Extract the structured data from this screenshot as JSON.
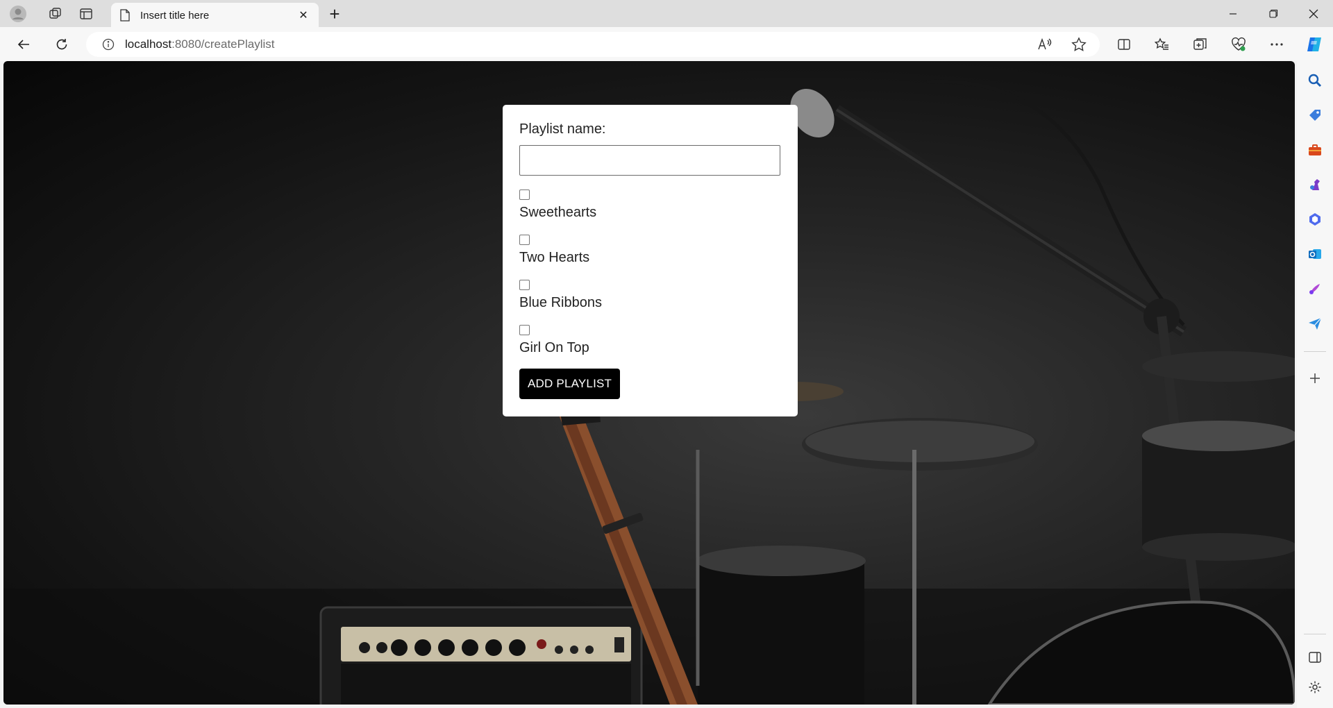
{
  "browser": {
    "tab_title": "Insert title here",
    "url_host": "localhost",
    "url_rest": ":8080/createPlaylist"
  },
  "form": {
    "name_label": "Playlist name:",
    "name_value": "",
    "songs": [
      {
        "label": "Sweethearts",
        "checked": false
      },
      {
        "label": "Two Hearts",
        "checked": false
      },
      {
        "label": "Blue Ribbons",
        "checked": false
      },
      {
        "label": "Girl On Top",
        "checked": false
      }
    ],
    "submit_label": "ADD PLAYLIST"
  },
  "colors": {
    "background": "#1a1a1a",
    "card": "#ffffff",
    "button": "#000000",
    "edge_blue": "#1a73e8"
  },
  "icons": {
    "sidebar": [
      "search-icon",
      "tag-icon",
      "toolbox-icon",
      "chess-icon",
      "copilot-app-icon",
      "outlook-icon",
      "designer-icon",
      "send-icon",
      "add-icon",
      "sidebar-toggle-icon",
      "settings-icon"
    ]
  }
}
